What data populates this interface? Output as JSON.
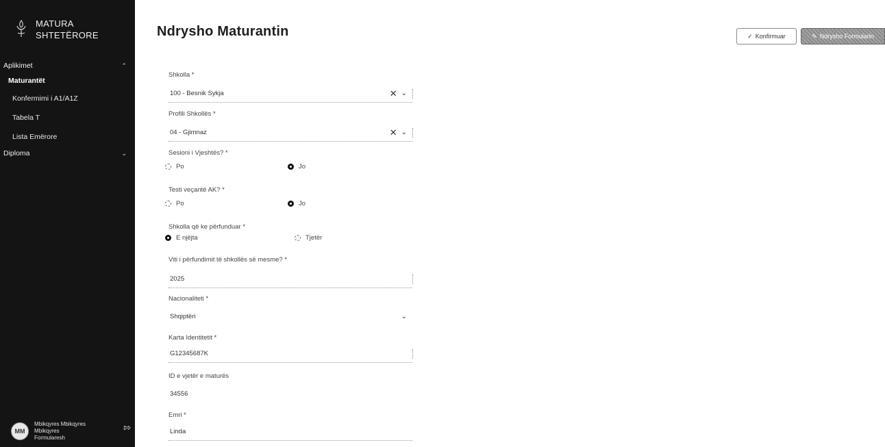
{
  "sidebar": {
    "brand": {
      "line1": "MATURA",
      "line2": "SHTETËRORE"
    },
    "groups": [
      {
        "label": "Aplikimet",
        "items": [
          {
            "label": "Maturantët"
          },
          {
            "label": "Konfermimi i A1/A1Z"
          },
          {
            "label": "Tabela T"
          },
          {
            "label": "Lista Emërore"
          }
        ]
      },
      {
        "label": "Diploma"
      }
    ],
    "user": {
      "initials": "MM",
      "name": "Mbikqyres Mbikqyres",
      "role": "Mbikqyres",
      "sub": "Formularesh"
    }
  },
  "header": {
    "title": "Ndrysho Maturantin",
    "confirm_label": "Konfirmuar",
    "edit_label": "Ndrysho Formularin"
  },
  "form": {
    "shkolla": {
      "label": "Shkolla *",
      "value": "100 - Besnik Sykja"
    },
    "profili": {
      "label": "Profili Shkollës *",
      "value": "04 - Gjimnaz"
    },
    "sesioni": {
      "label": "Sesioni i Vjeshtës? *",
      "options": [
        "Po",
        "Jo"
      ],
      "selected": "Jo"
    },
    "testi": {
      "label": "Testi veçantë AK? *",
      "options": [
        "Po",
        "Jo"
      ],
      "selected": "Jo"
    },
    "shkolla_perfunduar": {
      "label": "Shkolla që ke përfunduar *",
      "options": [
        "E njëjta",
        "Tjetër"
      ],
      "selected": "E njëjta"
    },
    "viti": {
      "label": "Viti i përfundimit të shkollës së mesme? *",
      "value": "2025"
    },
    "nacionaliteti": {
      "label": "Nacionaliteti *",
      "value": "Shqiptëri"
    },
    "karta": {
      "label": "Karta Identitetit *",
      "value": "G12345687K"
    },
    "id_maturant": {
      "label": "ID e vjetër e maturës",
      "value": "34556"
    },
    "emri": {
      "label": "Emri *",
      "value": "Linda"
    }
  }
}
